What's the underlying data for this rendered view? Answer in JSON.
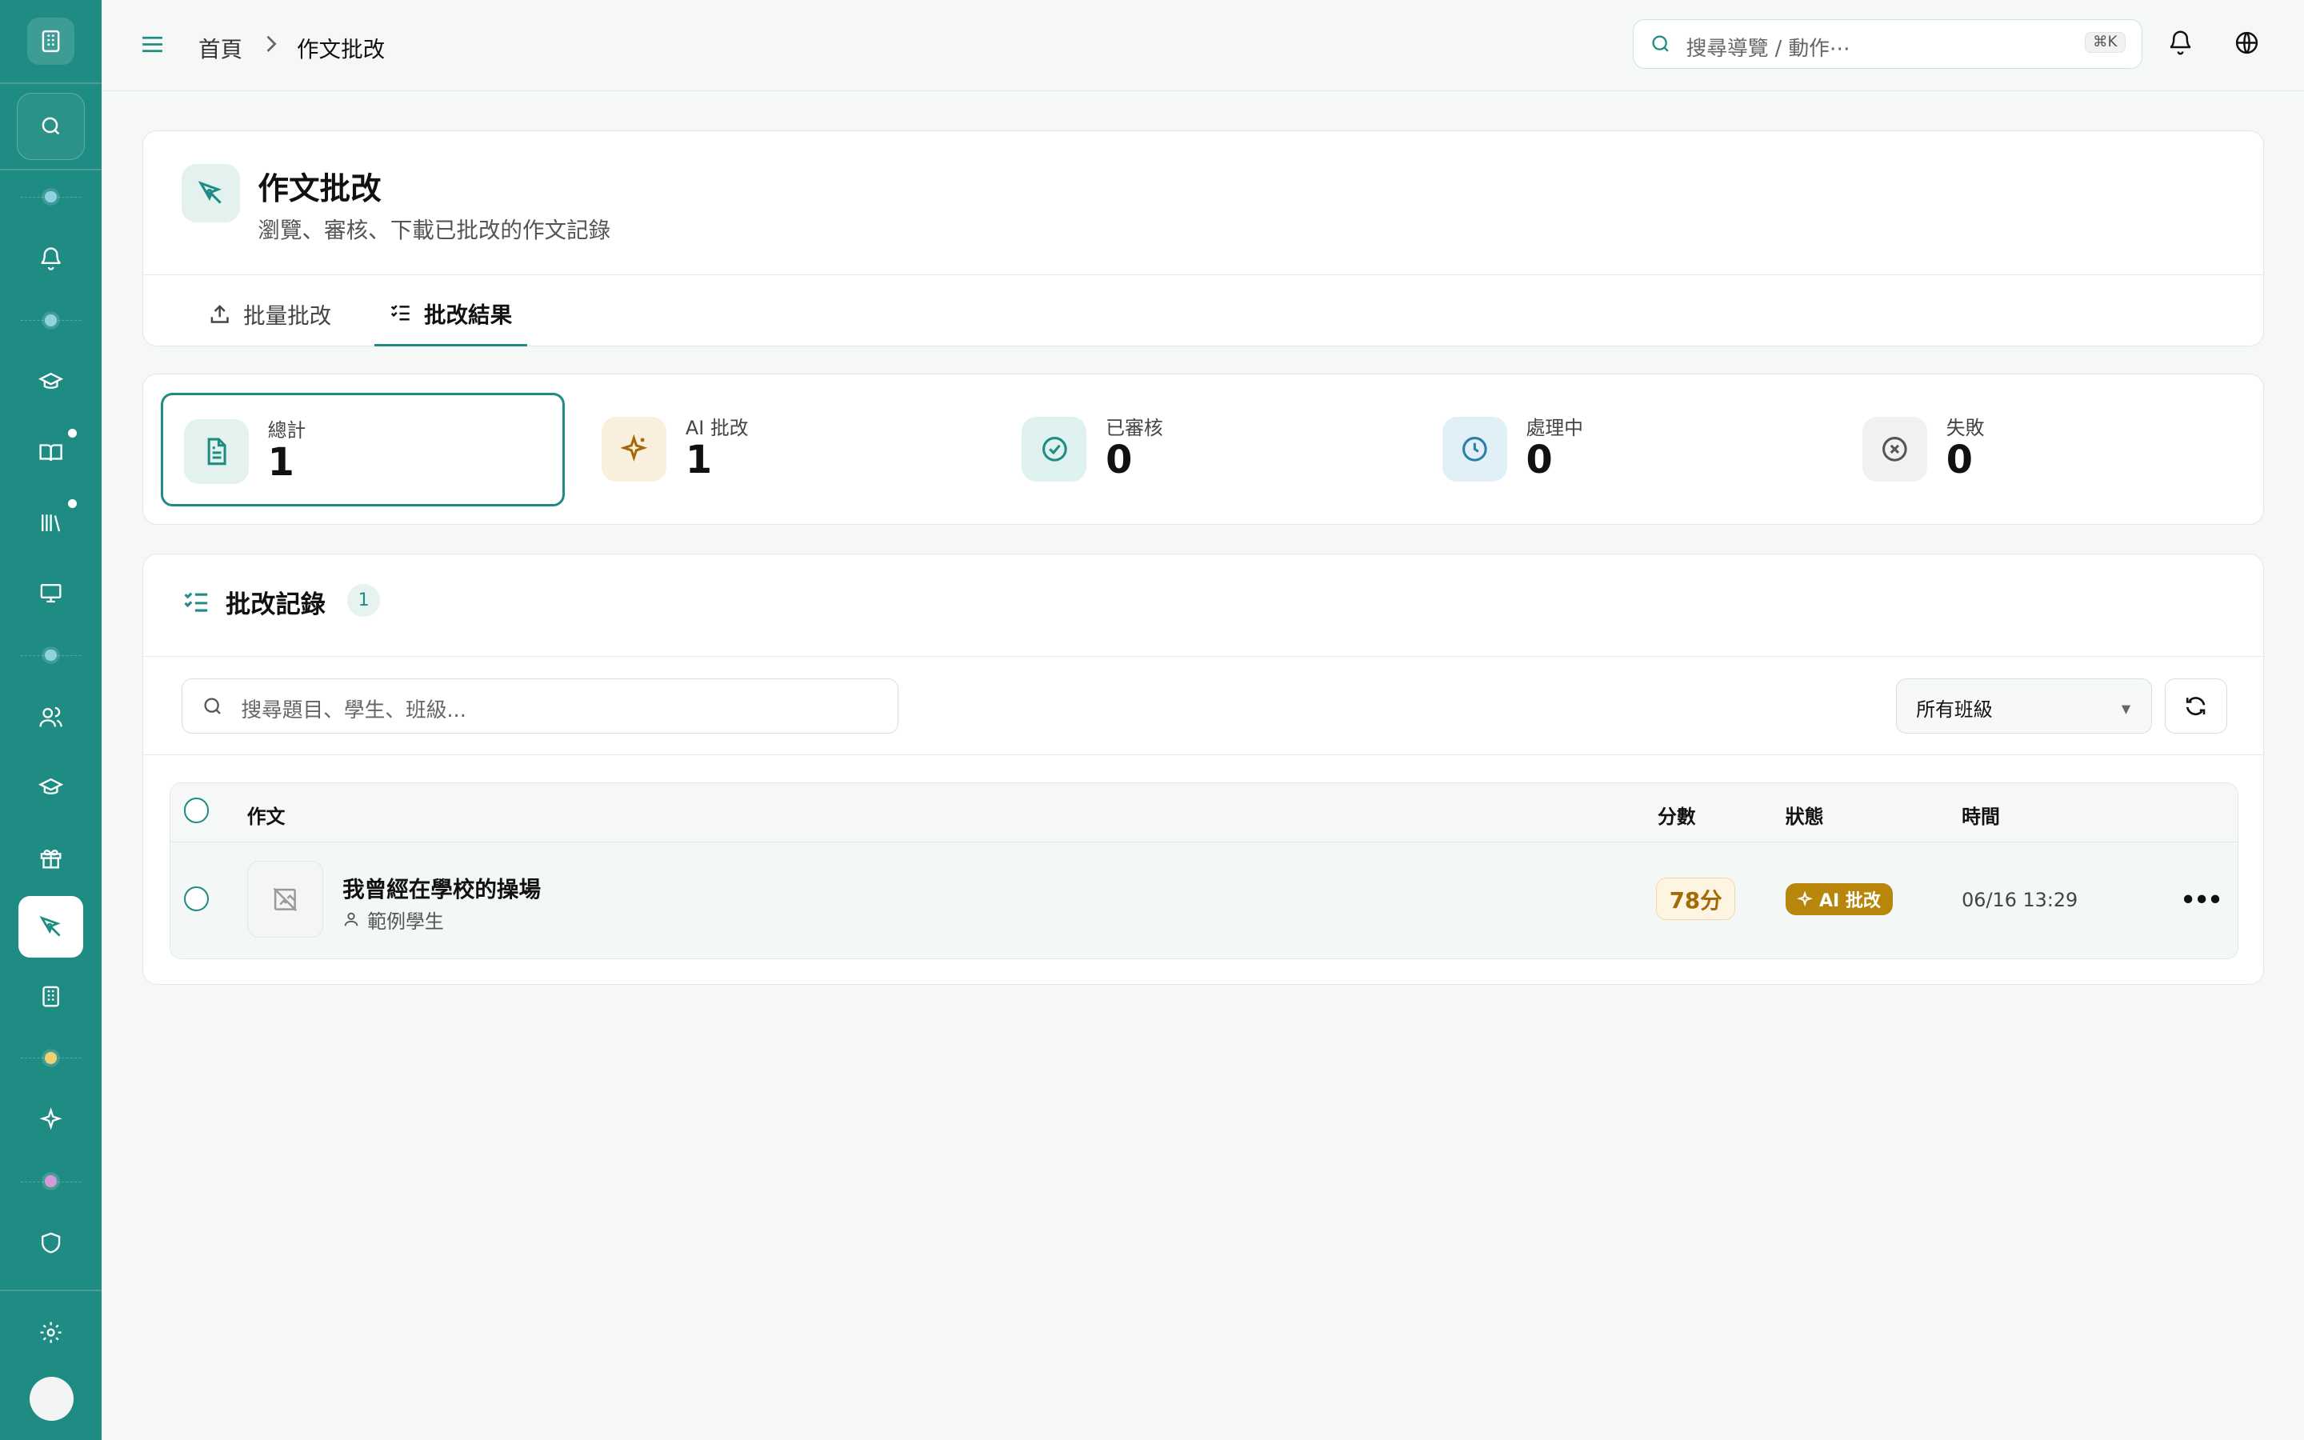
{
  "sidebar": {
    "badge_color": "#1e8c83",
    "items": [
      {
        "icon": "bell-icon"
      },
      {
        "icon": "graduation-cap-icon"
      },
      {
        "icon": "book-open-icon"
      },
      {
        "icon": "library-icon"
      },
      {
        "icon": "monitor-icon"
      },
      {
        "icon": "users-icon"
      },
      {
        "icon": "graduation-cap-icon"
      },
      {
        "icon": "gift-icon"
      },
      {
        "icon": "pen-tool-icon",
        "active": true
      },
      {
        "icon": "building-icon"
      },
      {
        "icon": "sparkles-icon"
      },
      {
        "icon": "shield-icon"
      },
      {
        "icon": "gear-icon"
      }
    ]
  },
  "topbar": {
    "breadcrumb_home": "首頁",
    "breadcrumb_current": "作文批改",
    "search_placeholder": "搜尋導覽 / 動作⋯",
    "search_shortcut": "⌘K"
  },
  "header": {
    "title": "作文批改",
    "subtitle": "瀏覽、審核、下載已批改的作文記錄",
    "tabs": [
      {
        "label": "批量批改",
        "icon": "upload-icon"
      },
      {
        "label": "批改結果",
        "icon": "list-checks-icon",
        "active": true
      }
    ]
  },
  "stats": [
    {
      "label": "總計",
      "value": "1",
      "icon": "file-text-icon",
      "color": "#1e8c83",
      "bg": "#e3f1ef"
    },
    {
      "label": "AI 批改",
      "value": "1",
      "icon": "sparkles-icon",
      "color": "#a36b06",
      "bg": "#f8efdc"
    },
    {
      "label": "已審核",
      "value": "0",
      "icon": "check-circle-icon",
      "color": "#1e8c83",
      "bg": "#e0f2ef"
    },
    {
      "label": "處理中",
      "value": "0",
      "icon": "clock-icon",
      "color": "#2a7fa8",
      "bg": "#e1eff7"
    },
    {
      "label": "失敗",
      "value": "0",
      "icon": "x-circle-icon",
      "color": "#555555",
      "bg": "#f0f1f1"
    }
  ],
  "list": {
    "title": "批改記錄",
    "count": "1",
    "search_placeholder": "搜尋題目、學生、班級...",
    "class_filter": "所有班級",
    "columns": {
      "essay": "作文",
      "score": "分數",
      "status": "狀態",
      "time": "時間"
    },
    "rows": [
      {
        "title": "我曾經在學校的操場",
        "student": "範例學生",
        "score": "78分",
        "status": "AI 批改",
        "time": "06/16 13:29"
      }
    ]
  }
}
